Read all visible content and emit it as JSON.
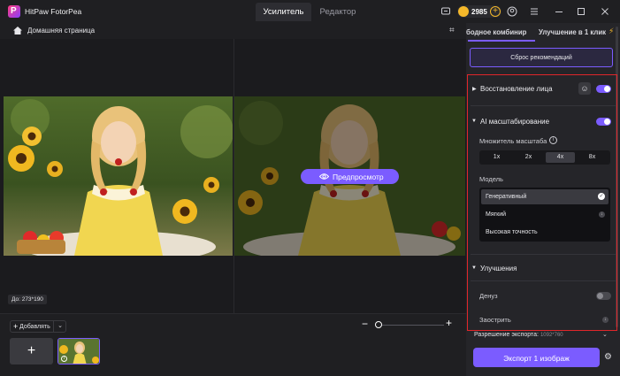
{
  "app": {
    "title": "HitPaw FotorPea"
  },
  "tabs": [
    {
      "label": "Усилитель"
    },
    {
      "label": "Редактор"
    }
  ],
  "credits": {
    "value": "2985"
  },
  "colors": {
    "accent": "#7b5cff",
    "highlight_border": "#e0262a",
    "coin": "#f5b82a"
  },
  "breadcrumb": {
    "home": "Домашняя страница"
  },
  "canvas": {
    "preview_label": "Предпросмотр",
    "before_dims": "До: 273*190"
  },
  "bottom": {
    "add_label": "Добавлять",
    "zoom_level": 0
  },
  "panel": {
    "tab1": "бодное комбинир",
    "tab2": "Улучшение в 1 клик",
    "reset": "Сброс рекомендаций",
    "face": {
      "title": "Восстановление лица",
      "enabled": true
    },
    "upscale": {
      "title": "AI масштабирование",
      "enabled": true,
      "multiplier_label": "Множитель масштаба",
      "scales": [
        "1x",
        "2x",
        "4x",
        "8x"
      ],
      "selected_scale": "4x",
      "model_label": "Модель",
      "models": [
        {
          "label": "Генеративный",
          "state": "selected"
        },
        {
          "label": "Мягкий",
          "state": "download"
        },
        {
          "label": "Высокая точность",
          "state": ""
        }
      ]
    },
    "improve": {
      "title": "Улучшения",
      "denoise": {
        "label": "Денуз",
        "enabled": false
      },
      "sharpen": {
        "label": "Заострить"
      }
    },
    "export": {
      "resolution_label": "Разрешение экспорта:",
      "resolution_value": "1092*760",
      "button": "Экспорт 1 изображ"
    }
  }
}
